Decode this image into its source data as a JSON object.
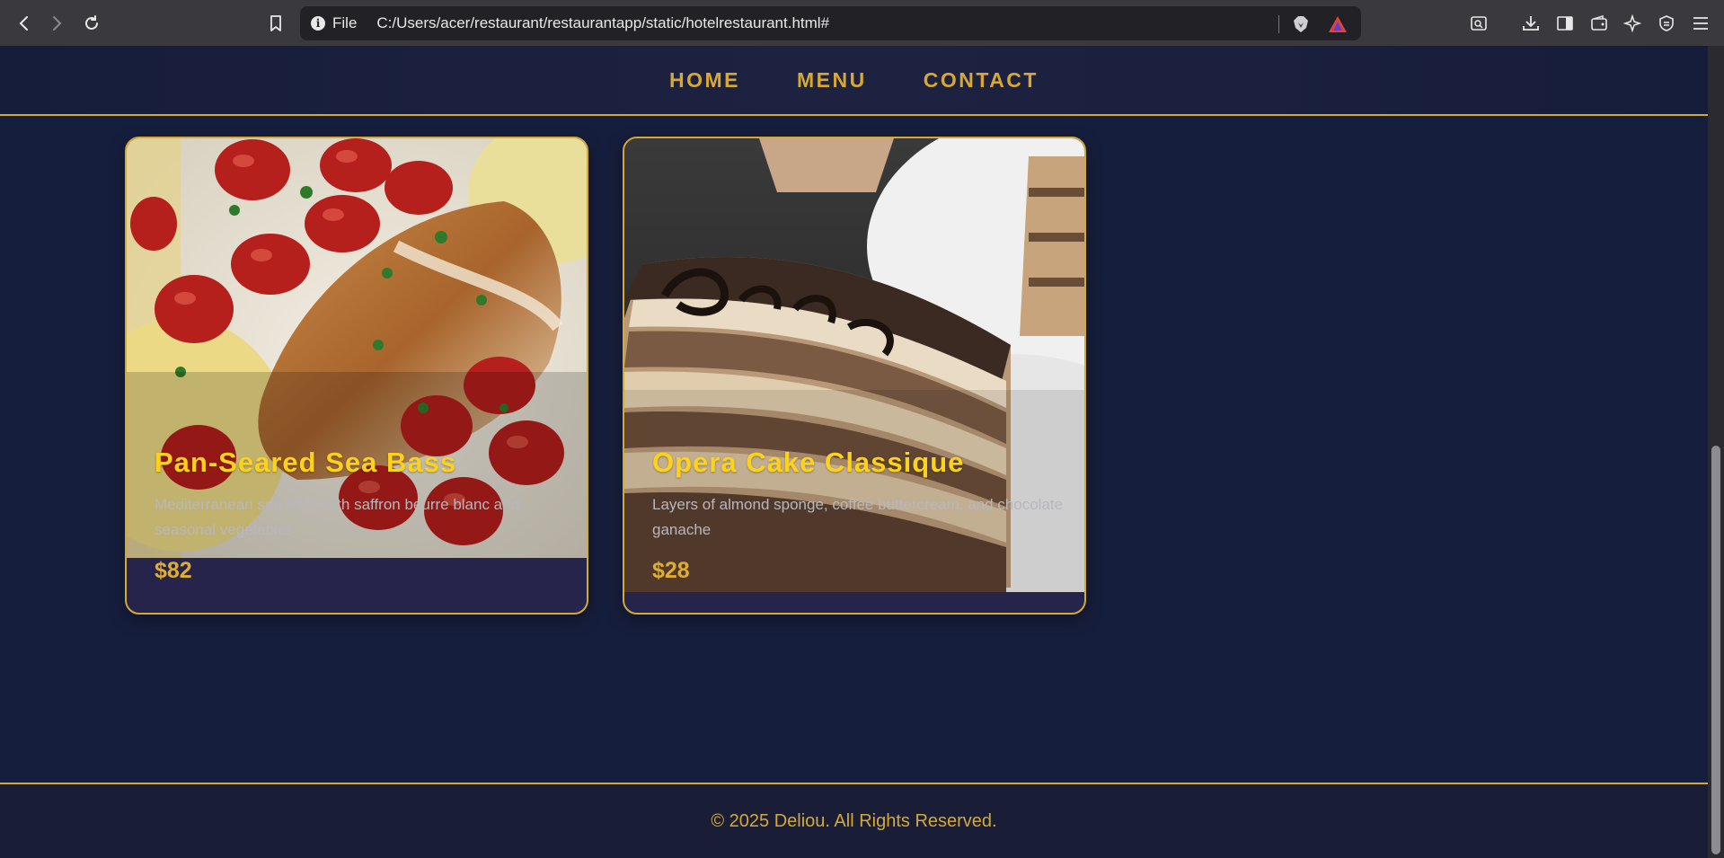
{
  "browser": {
    "file_label": "File",
    "url": "C:/Users/acer/restaurant/restaurantapp/static/hotelrestaurant.html#"
  },
  "nav": {
    "home": "HOME",
    "menu": "MENU",
    "contact": "CONTACT"
  },
  "cards": [
    {
      "title": "Pan-Seared Sea Bass",
      "description": "Mediterranean sea bass with saffron beurre blanc and seasonal vegetables",
      "price": "$82"
    },
    {
      "title": "Opera Cake Classique",
      "description": "Layers of almond sponge, coffee buttercream, and chocolate ganache",
      "price": "$28"
    }
  ],
  "footer": {
    "copyright": "© 2025 Deliou. All Rights Reserved."
  },
  "colors": {
    "accent_gold": "#d4a93a",
    "title_yellow": "#ffd21a",
    "background_navy": "#161e3d"
  }
}
